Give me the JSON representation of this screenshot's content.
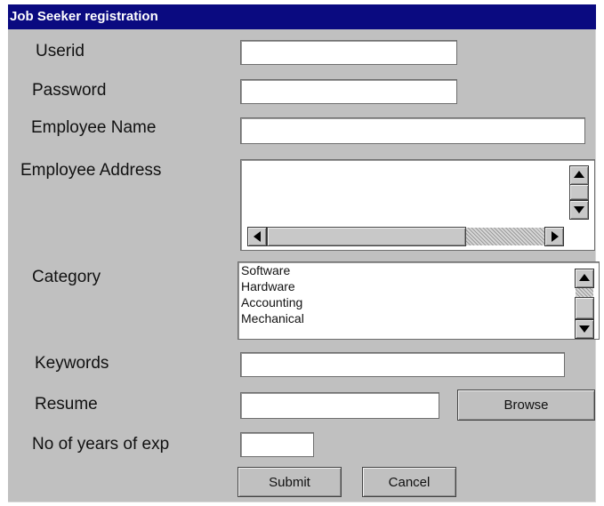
{
  "window": {
    "title": "Job Seeker registration"
  },
  "form": {
    "labels": {
      "userid": "Userid",
      "password": "Password",
      "employee_name": "Employee Name",
      "employee_address": "Employee Address",
      "category": "Category",
      "keywords": "Keywords",
      "resume": "Resume",
      "years_exp": "No of years of exp"
    },
    "values": {
      "userid": "",
      "password": "",
      "employee_name": "",
      "employee_address": "",
      "keywords": "",
      "resume": "",
      "years_exp": ""
    },
    "category_options": [
      "Software",
      "Hardware",
      "Accounting",
      "Mechanical"
    ]
  },
  "buttons": {
    "browse": "Browse",
    "submit": "Submit",
    "cancel": "Cancel"
  },
  "colors": {
    "title_bar": "#0a0a80",
    "window_background": "#c0c0c0"
  },
  "icons": {
    "scroll_up": "up-arrow-icon",
    "scroll_down": "down-arrow-icon",
    "scroll_left": "left-arrow-icon",
    "scroll_right": "right-arrow-icon"
  }
}
